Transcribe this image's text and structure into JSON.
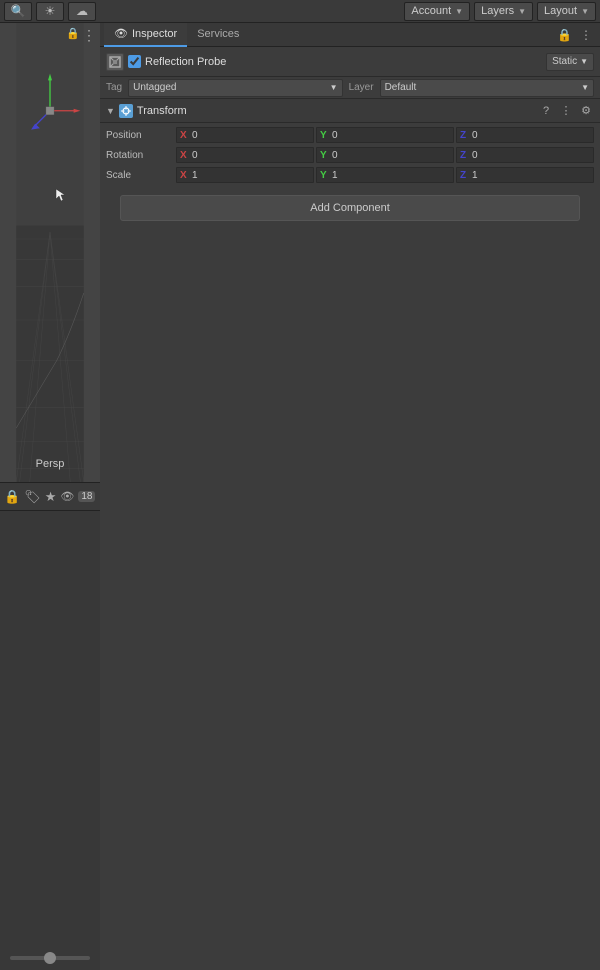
{
  "topbar": {
    "search_icon": "🔍",
    "sun_icon": "☀",
    "cloud_icon": "☁",
    "account_label": "Account",
    "layers_label": "Layers",
    "layout_label": "Layout"
  },
  "tabs": {
    "inspector_label": "Inspector",
    "services_label": "Services"
  },
  "object": {
    "name": "Reflection Probe",
    "static_label": "Static",
    "tag_label": "Tag",
    "tag_value": "Untagged",
    "layer_label": "Layer",
    "layer_value": "Default"
  },
  "transform": {
    "component_name": "Transform",
    "position_label": "Position",
    "rotation_label": "Rotation",
    "scale_label": "Scale",
    "position": {
      "x": "0",
      "y": "0",
      "z": "0"
    },
    "rotation": {
      "x": "0",
      "y": "0",
      "z": "0"
    },
    "scale": {
      "x": "1",
      "y": "1",
      "z": "1"
    }
  },
  "add_component": {
    "label": "Add Component"
  },
  "scene": {
    "persp_label": "Persp",
    "badge_count": "18"
  }
}
